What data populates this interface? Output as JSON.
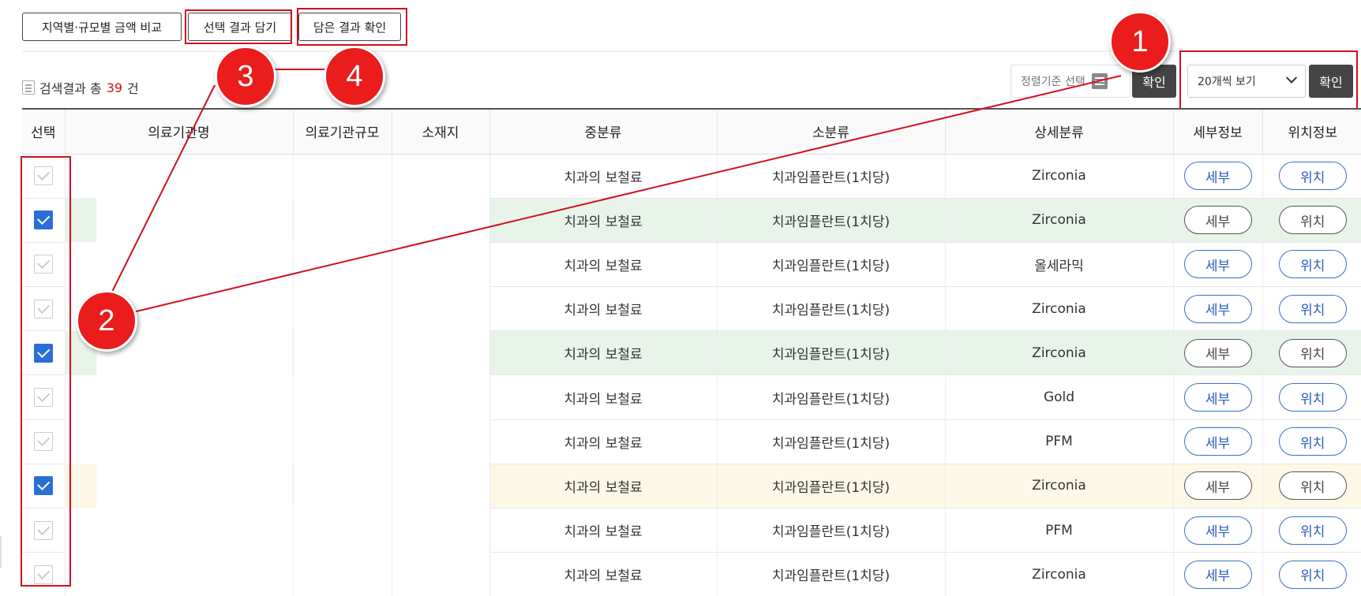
{
  "toolbar": {
    "compare_label": "지역별·규모별 금액 비교",
    "save_selected_label": "선택 결과 담기",
    "view_saved_label": "담은 결과 확인"
  },
  "result": {
    "prefix": "검색결과 총",
    "count": "39",
    "suffix": "건"
  },
  "controls": {
    "sort_placeholder": "정렬기준 선택",
    "confirm_label": "확인",
    "page_size_value": "20개씩 보기",
    "confirm2_label": "확인"
  },
  "table": {
    "headers": [
      "선택",
      "의료기관명",
      "의료기관규모",
      "소재지",
      "중분류",
      "소분류",
      "상세분류",
      "세부정보",
      "위치정보"
    ],
    "rows": [
      {
        "checked": false,
        "mid": "치과의 보철료",
        "sub": "치과임플란트(1치당)",
        "detail": "Zirconia",
        "detail_btn": "세부",
        "loc_btn": "위치",
        "highlight": "none"
      },
      {
        "checked": true,
        "mid": "치과의 보철료",
        "sub": "치과임플란트(1치당)",
        "detail": "Zirconia",
        "detail_btn": "세부",
        "loc_btn": "위치",
        "highlight": "green"
      },
      {
        "checked": false,
        "mid": "치과의 보철료",
        "sub": "치과임플란트(1치당)",
        "detail": "올세라믹",
        "detail_btn": "세부",
        "loc_btn": "위치",
        "highlight": "none"
      },
      {
        "checked": false,
        "mid": "치과의 보철료",
        "sub": "치과임플란트(1치당)",
        "detail": "Zirconia",
        "detail_btn": "세부",
        "loc_btn": "위치",
        "highlight": "none"
      },
      {
        "checked": true,
        "mid": "치과의 보철료",
        "sub": "치과임플란트(1치당)",
        "detail": "Zirconia",
        "detail_btn": "세부",
        "loc_btn": "위치",
        "highlight": "green"
      },
      {
        "checked": false,
        "mid": "치과의 보철료",
        "sub": "치과임플란트(1치당)",
        "detail": "Gold",
        "detail_btn": "세부",
        "loc_btn": "위치",
        "highlight": "none"
      },
      {
        "checked": false,
        "mid": "치과의 보철료",
        "sub": "치과임플란트(1치당)",
        "detail": "PFM",
        "detail_btn": "세부",
        "loc_btn": "위치",
        "highlight": "none"
      },
      {
        "checked": true,
        "mid": "치과의 보철료",
        "sub": "치과임플란트(1치당)",
        "detail": "Zirconia",
        "detail_btn": "세부",
        "loc_btn": "위치",
        "highlight": "yellow"
      },
      {
        "checked": false,
        "mid": "치과의 보철료",
        "sub": "치과임플란트(1치당)",
        "detail": "PFM",
        "detail_btn": "세부",
        "loc_btn": "위치",
        "highlight": "none"
      },
      {
        "checked": false,
        "mid": "치과의 보철료",
        "sub": "치과임플란트(1치당)",
        "detail": "Zirconia",
        "detail_btn": "세부",
        "loc_btn": "위치",
        "highlight": "none"
      }
    ]
  },
  "annotations": [
    "1",
    "2",
    "3",
    "4"
  ],
  "colors": {
    "accent_red": "#ea1c1c",
    "checkbox_blue": "#2a6fd6",
    "row_green": "#e8f4ea",
    "row_yellow": "#fdf8e6"
  }
}
